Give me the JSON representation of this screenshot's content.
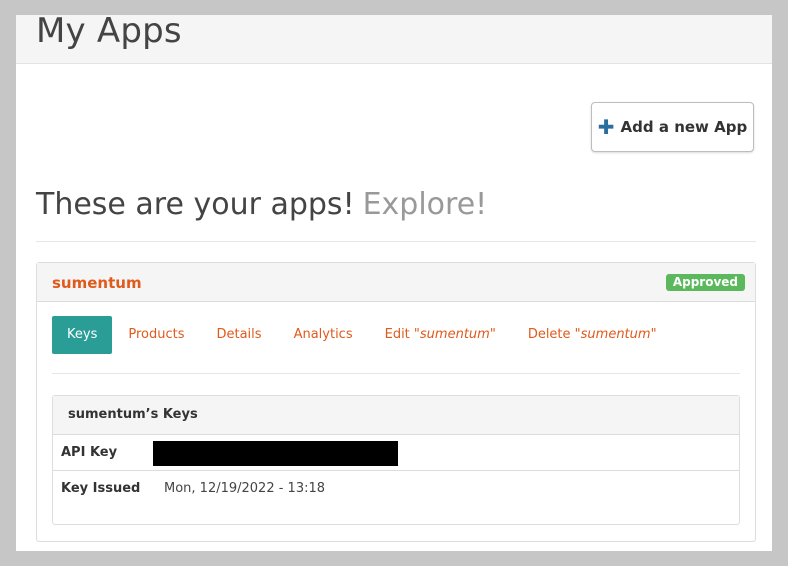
{
  "page": {
    "title": "My Apps"
  },
  "toolbar": {
    "add_label": "Add a new App",
    "add_icon": "plus-icon"
  },
  "hero": {
    "text": "These are your apps!",
    "explore": "Explore!"
  },
  "app": {
    "name": "sumentum",
    "status": "Approved",
    "status_color": "#5cb85c",
    "accent_color": "#e05a1c",
    "tabs": {
      "keys": "Keys",
      "products": "Products",
      "details": "Details",
      "analytics": "Analytics",
      "edit_prefix": "Edit \"",
      "edit_name": "sumentum",
      "edit_suffix": "\"",
      "delete_prefix": "Delete \"",
      "delete_name": "sumentum",
      "delete_suffix": "\""
    },
    "active_tab_color": "#2a9d96",
    "keys_panel": {
      "title": "sumentum’s Keys",
      "rows": [
        {
          "label": "API Key",
          "value": ""
        },
        {
          "label": "Key Issued",
          "value": "Mon, 12/19/2022 - 13:18"
        }
      ]
    }
  }
}
